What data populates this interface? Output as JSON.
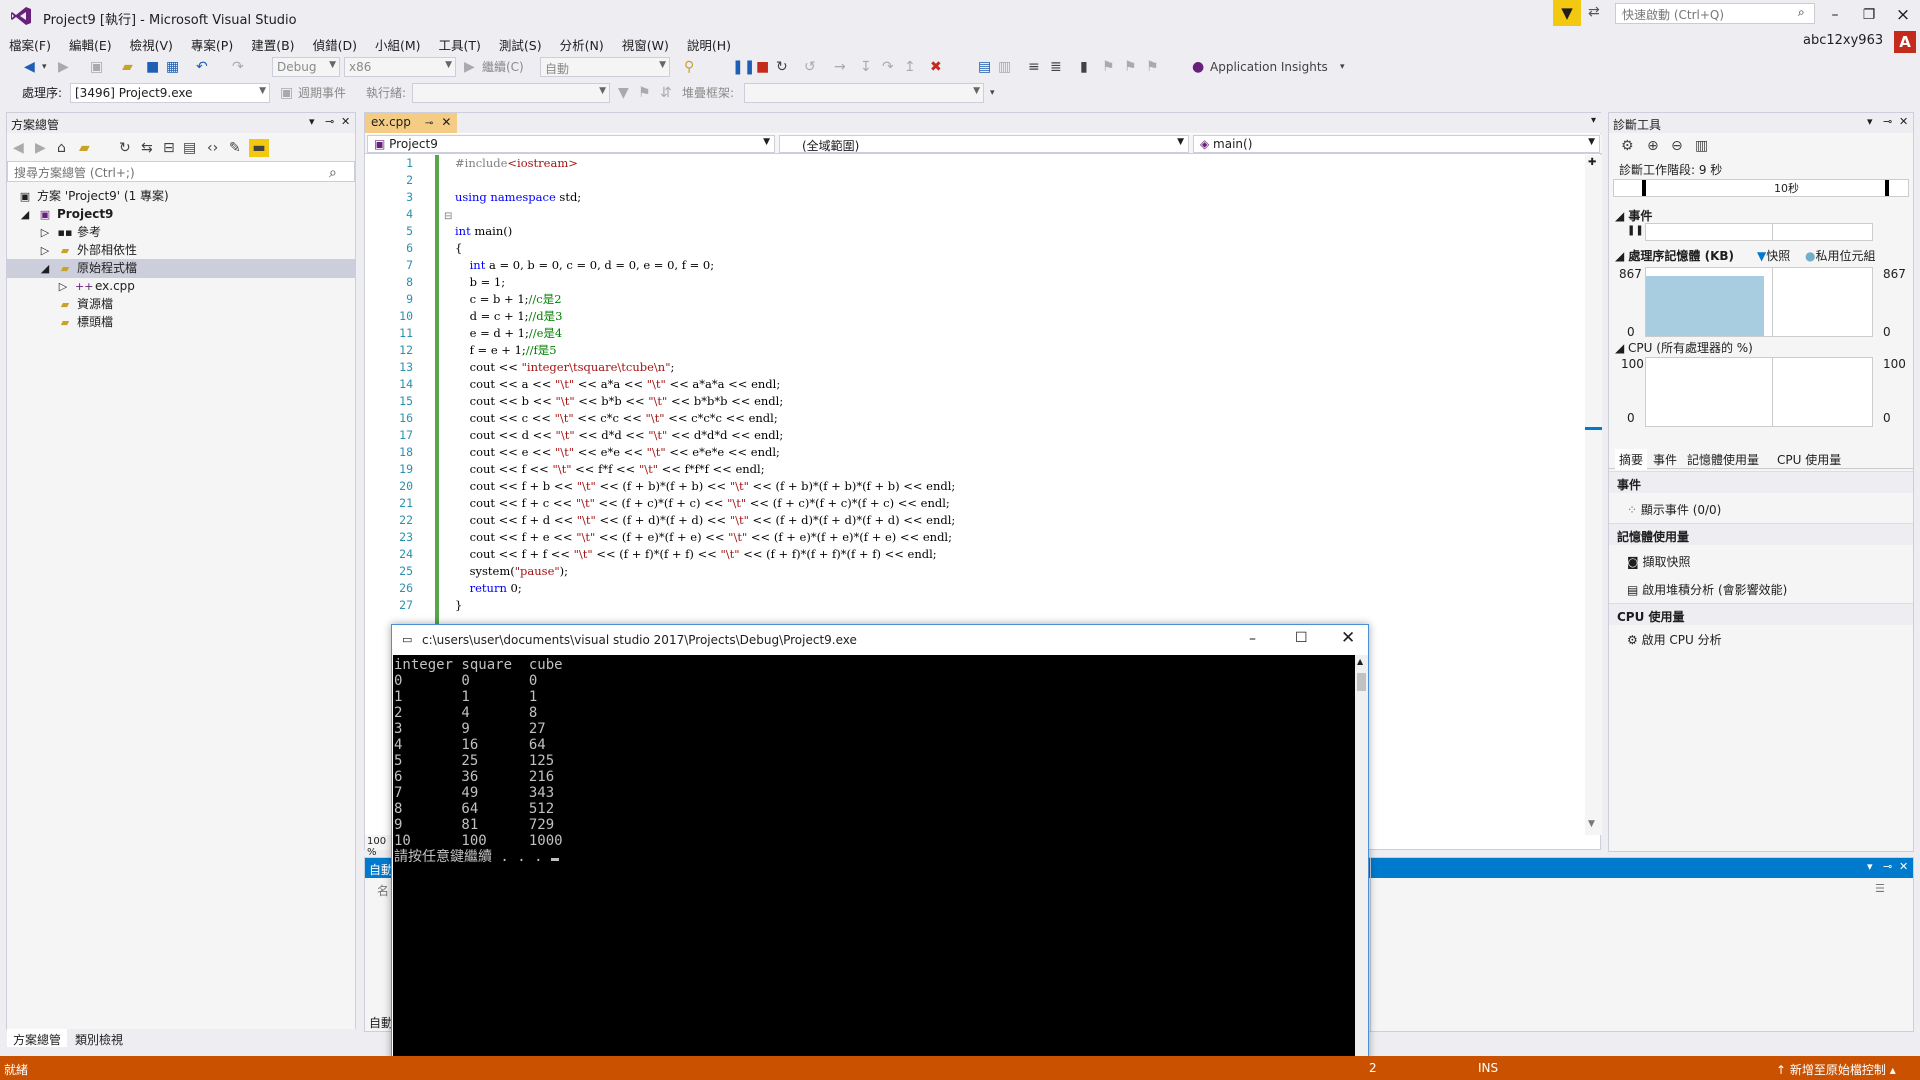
{
  "app": {
    "title": "Project9 [執行] - Microsoft Visual Studio",
    "quick_launch_placeholder": "快速啟動 (Ctrl+Q)",
    "user": "abc12xy963",
    "user_initial": "A",
    "accent_color": "#007acc",
    "status_color": "#ca5100"
  },
  "menu": [
    "檔案(F)",
    "編輯(E)",
    "檢視(V)",
    "專案(P)",
    "建置(B)",
    "偵錯(D)",
    "小組(M)",
    "工具(T)",
    "測試(S)",
    "分析(N)",
    "視窗(W)",
    "說明(H)"
  ],
  "toolbar": {
    "config": "Debug",
    "platform": "x86",
    "continue_label": "繼續(C)",
    "auto": "自動",
    "app_insights": "Application Insights",
    "process_label": "處理序:",
    "process_value": "[3496] Project9.exe",
    "lifecycle_label": "週期事件",
    "thread_label": "執行緒:",
    "stack_label": "堆疊框架:"
  },
  "solution_explorer": {
    "title": "方案總管",
    "search_placeholder": "搜尋方案總管 (Ctrl+;)",
    "items": [
      {
        "label": "方案 'Project9' (1 專案)",
        "icon": "solution-icon"
      },
      {
        "label": "Project9",
        "icon": "project-icon"
      },
      {
        "label": "參考",
        "icon": "references-icon"
      },
      {
        "label": "外部相依性",
        "icon": "folder-icon"
      },
      {
        "label": "原始程式檔",
        "icon": "folder-icon"
      },
      {
        "label": "ex.cpp",
        "icon": "cpp-file-icon"
      },
      {
        "label": "資源檔",
        "icon": "folder-icon"
      },
      {
        "label": "標頭檔",
        "icon": "folder-icon"
      }
    ],
    "tabs": [
      "方案總管",
      "類別檢視"
    ]
  },
  "editor": {
    "tab": "ex.cpp",
    "nav_project": "Project9",
    "nav_scope": "(全域範圍)",
    "nav_member": "main()",
    "zoom": "100 %",
    "line_numbers": [
      "1",
      "2",
      "3",
      "4",
      "5",
      "6",
      "7",
      "8",
      "9",
      "10",
      "11",
      "12",
      "13",
      "14",
      "15",
      "16",
      "17",
      "18",
      "19",
      "20",
      "21",
      "22",
      "23",
      "24",
      "25",
      "26",
      "27"
    ]
  },
  "output_panel": {
    "title_fragment": "自動",
    "tab_fragment": "自動",
    "col_fragment": "名"
  },
  "diagnostics": {
    "title": "診斷工具",
    "session": "診斷工作階段: 9 秒",
    "tick": "10秒",
    "events": "事件",
    "memory": "處理序記憶體 (KB)",
    "snapshot_legend": "快照",
    "private_legend": "私用位元組",
    "mem_max": "867",
    "mem_min": "0",
    "cpu": "CPU (所有處理器的 %)",
    "cpu_max": "100",
    "cpu_min": "0",
    "tabs": [
      "摘要",
      "事件",
      "記憶體使用量",
      "CPU 使用量"
    ],
    "sec_events": "事件",
    "show_events": "顯示事件 (0/0)",
    "sec_memory": "記憶體使用量",
    "take_snapshot": "擷取快照",
    "heap_profiling": "啟用堆積分析 (會影響效能)",
    "sec_cpu": "CPU 使用量",
    "enable_cpu": "啟用 CPU 分析"
  },
  "console": {
    "title": "c:\\users\\user\\documents\\visual studio 2017\\Projects\\Debug\\Project9.exe",
    "lines": [
      "integer square  cube",
      "0       0       0",
      "1       1       1",
      "2       4       8",
      "3       9       27",
      "4       16      64",
      "5       25      125",
      "6       36      216",
      "7       49      343",
      "8       64      512",
      "9       81      729",
      "10      100     1000",
      "請按任意鍵繼續 . . . "
    ]
  },
  "statusbar": {
    "ready": "就緒",
    "col": "2",
    "ins": "INS",
    "source_control": "新增至原始檔控制"
  }
}
